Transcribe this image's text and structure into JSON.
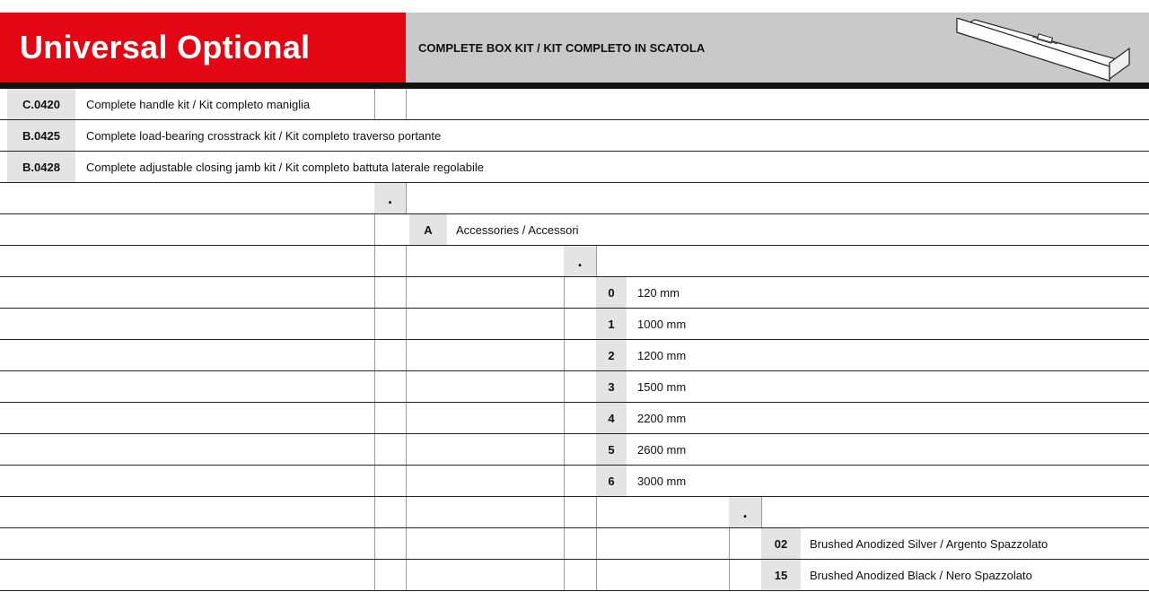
{
  "header": {
    "title": "Universal Optional",
    "subtitle": "COMPLETE BOX KIT / KIT COMPLETO IN SCATOLA",
    "product_image": "box-kit-profile-icon"
  },
  "colors": {
    "brand_red": "#e30613",
    "header_grey": "#c9c9c9",
    "code_cell_grey": "#e4e4e4"
  },
  "kits": [
    {
      "code": "C.0420",
      "description": "Complete handle kit / Kit completo maniglia"
    },
    {
      "code": "B.0425",
      "description": "Complete load-bearing crosstrack kit / Kit completo traverso portante"
    },
    {
      "code": "B.0428",
      "description": "Complete adjustable closing jamb kit / Kit completo battuta laterale regolabile"
    }
  ],
  "separator": ".",
  "accessory": {
    "code": "A",
    "description": "Accessories / Accessori"
  },
  "lengths": [
    {
      "code": "0",
      "description": "120 mm"
    },
    {
      "code": "1",
      "description": "1000 mm"
    },
    {
      "code": "2",
      "description": "1200 mm"
    },
    {
      "code": "3",
      "description": "1500 mm"
    },
    {
      "code": "4",
      "description": "2200 mm"
    },
    {
      "code": "5",
      "description": "2600 mm"
    },
    {
      "code": "6",
      "description": "3000 mm"
    }
  ],
  "finishes": [
    {
      "code": "02",
      "description": "Brushed Anodized Silver / Argento Spazzolato"
    },
    {
      "code": "15",
      "description": "Brushed Anodized Black / Nero Spazzolato"
    }
  ]
}
